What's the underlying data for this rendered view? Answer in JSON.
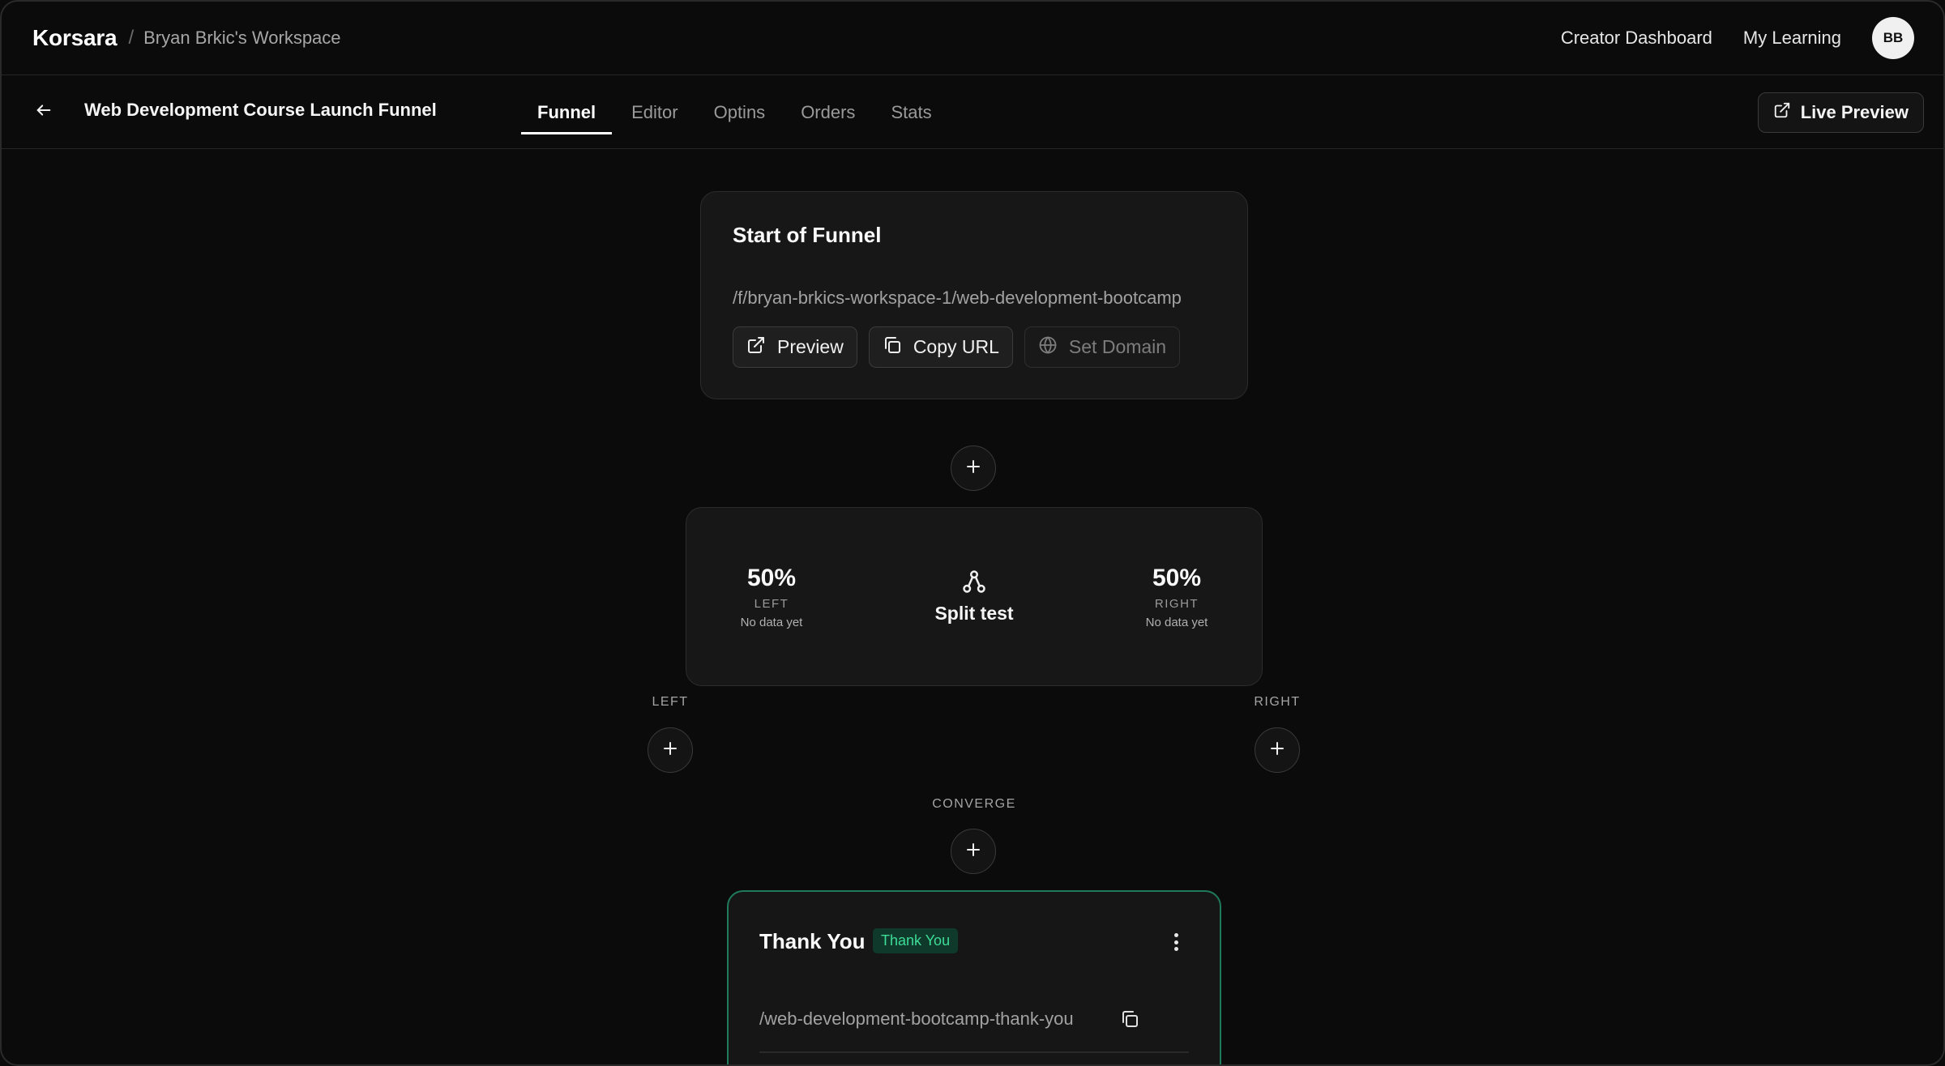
{
  "header": {
    "brand": "Korsara",
    "separator": "/",
    "workspace": "Bryan Brkic's Workspace",
    "links": [
      "Creator Dashboard",
      "My Learning"
    ],
    "avatar_initials": "BB"
  },
  "subheader": {
    "title": "Web Development Course Launch Funnel",
    "tabs": [
      {
        "label": "Funnel",
        "active": true
      },
      {
        "label": "Editor",
        "active": false
      },
      {
        "label": "Optins",
        "active": false
      },
      {
        "label": "Orders",
        "active": false
      },
      {
        "label": "Stats",
        "active": false
      }
    ],
    "live_preview_label": "Live Preview"
  },
  "start_card": {
    "title": "Start of Funnel",
    "url": "/f/bryan-brkics-workspace-1/web-development-bootcamp",
    "buttons": {
      "preview": "Preview",
      "copy_url": "Copy URL",
      "set_domain": "Set Domain"
    }
  },
  "split_test": {
    "label": "Split test",
    "left": {
      "percent": "50%",
      "side": "LEFT",
      "status": "No data yet"
    },
    "right": {
      "percent": "50%",
      "side": "RIGHT",
      "status": "No data yet"
    }
  },
  "branches": {
    "left_label": "LEFT",
    "right_label": "RIGHT",
    "converge_label": "CONVERGE"
  },
  "thank_you_card": {
    "title": "Thank You",
    "badge": "Thank You",
    "url": "/web-development-bootcamp-thank-you"
  },
  "colors": {
    "background": "#0b0b0b",
    "card": "#171717",
    "accent_green": "#3ddc97",
    "accent_border": "#1f7a5a"
  }
}
